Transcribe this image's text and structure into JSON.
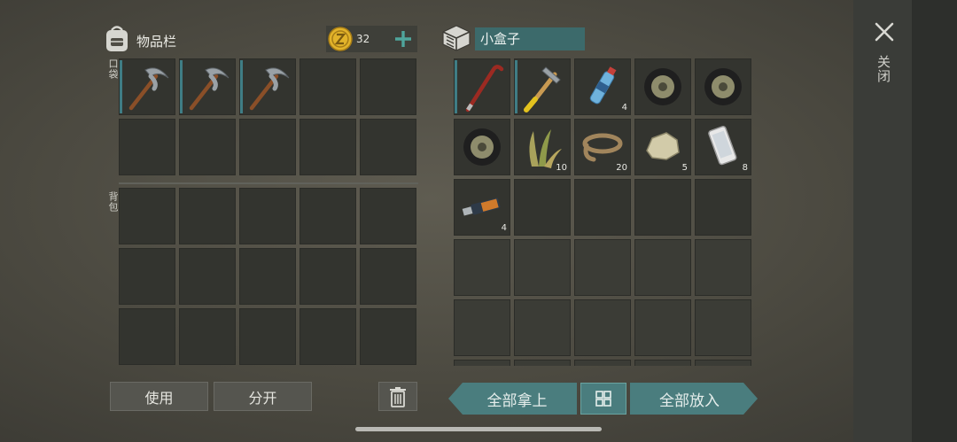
{
  "inventory": {
    "title": "物品栏",
    "coin_count": "32",
    "pocket_label": "口袋",
    "backpack_label": "背包",
    "pocket_slots": [
      {
        "item": "pickaxe-icon"
      },
      {
        "item": "pickaxe-icon"
      },
      {
        "item": "pickaxe-icon"
      },
      {
        "item": ""
      },
      {
        "item": ""
      },
      {
        "item": ""
      },
      {
        "item": ""
      },
      {
        "item": ""
      },
      {
        "item": ""
      },
      {
        "item": ""
      }
    ],
    "backpack_slot_count": 15
  },
  "container": {
    "name": "小盒子",
    "items": [
      {
        "item": "crowbar-icon",
        "qty": ""
      },
      {
        "item": "hammer-icon",
        "qty": ""
      },
      {
        "item": "water-bottle-icon",
        "qty": "4"
      },
      {
        "item": "tire-icon",
        "qty": ""
      },
      {
        "item": "tire-icon",
        "qty": ""
      },
      {
        "item": "tire-icon",
        "qty": ""
      },
      {
        "item": "plant-fiber-icon",
        "qty": "10"
      },
      {
        "item": "rope-icon",
        "qty": "20"
      },
      {
        "item": "stone-icon",
        "qty": "5"
      },
      {
        "item": "smartphone-icon",
        "qty": "8"
      },
      {
        "item": "usb-drive-icon",
        "qty": "4"
      }
    ]
  },
  "buttons": {
    "use": "使用",
    "split": "分开",
    "take_all": "全部拿上",
    "put_all": "全部放入",
    "close": "关闭"
  },
  "colors": {
    "teal": "#4a7d7e",
    "durability": "#3f7d85",
    "coin": "#e2b32a"
  }
}
